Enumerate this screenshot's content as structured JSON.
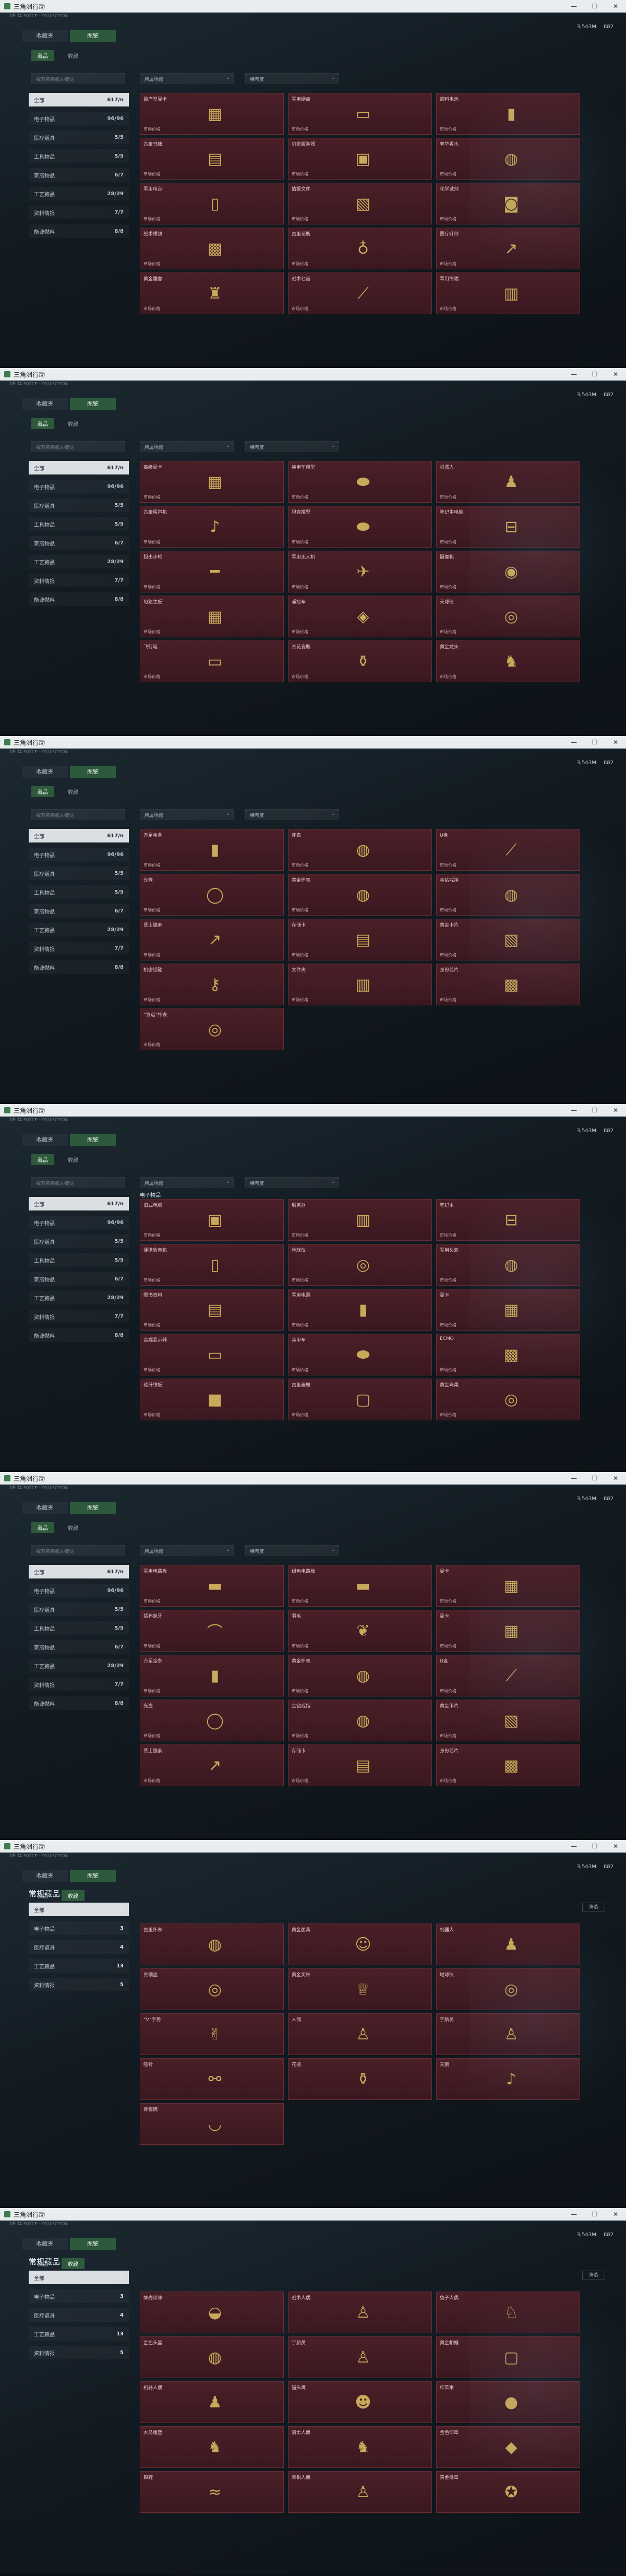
{
  "window": {
    "title": "三角洲行动",
    "min": "—",
    "max": "☐",
    "close": "✕"
  },
  "topstrip_text": "DELTA FORCE · COLLECTION",
  "currency": {
    "a": "3,543M",
    "b": "682"
  },
  "navtabs": [
    "收藏夹",
    "图鉴"
  ],
  "subtabs": [
    "藏品",
    "收藏"
  ],
  "search_placeholder": "搜索名称或关键词",
  "dropdowns": [
    "所属地图",
    "稀有度"
  ],
  "categories": [
    {
      "label": "全部",
      "count": "617/n"
    },
    {
      "label": "电子物品",
      "count": "96/96"
    },
    {
      "label": "医疗道具",
      "count": "5/5"
    },
    {
      "label": "工具物品",
      "count": "5/5"
    },
    {
      "label": "家居物品",
      "count": "6/7"
    },
    {
      "label": "工艺藏品",
      "count": "28/29"
    },
    {
      "label": "资料情报",
      "count": "7/7"
    },
    {
      "label": "能源燃料",
      "count": "8/8"
    }
  ],
  "price_label": "市场价格",
  "section_title": "电子物品",
  "header_title": "常规藏品",
  "mini_button": "筛选",
  "s6_categories": [
    {
      "label": "全部",
      "count": "25"
    },
    {
      "label": "电子物品",
      "count": "3"
    },
    {
      "label": "医疗道具",
      "count": "4"
    },
    {
      "label": "工艺藏品",
      "count": "13"
    },
    {
      "label": "资料情报",
      "count": "5"
    }
  ],
  "screens": [
    {
      "cards": [
        {
          "name": "量产型显卡",
          "icon": "chip-icon",
          "sym": "▦"
        },
        {
          "name": "军用硬盘",
          "icon": "drive-icon",
          "sym": "▭"
        },
        {
          "name": "燃料电池",
          "icon": "battery-icon",
          "sym": "▮"
        },
        {
          "name": "古董书籍",
          "icon": "book-icon",
          "sym": "▤"
        },
        {
          "name": "机密服务器",
          "icon": "server-icon",
          "sym": "▣"
        },
        {
          "name": "奢华香水",
          "icon": "perfume-icon",
          "sym": "◍"
        },
        {
          "name": "军用电台",
          "icon": "radio-icon",
          "sym": "▯"
        },
        {
          "name": "情报文件",
          "icon": "file-icon",
          "sym": "▧"
        },
        {
          "name": "化学试剂",
          "icon": "flask-icon",
          "sym": "◙"
        },
        {
          "name": "战术眼镜",
          "icon": "goggles-icon",
          "sym": "▩"
        },
        {
          "name": "古董花瓶",
          "icon": "vase-icon",
          "sym": "♁"
        },
        {
          "name": "医疗针剂",
          "icon": "syringe-icon",
          "sym": "↗"
        },
        {
          "name": "黄金雕像",
          "icon": "statue-icon",
          "sym": "♜"
        },
        {
          "name": "战术匕首",
          "icon": "knife-icon",
          "sym": "⟋"
        },
        {
          "name": "军用终端",
          "icon": "terminal-icon",
          "sym": "▥"
        }
      ]
    },
    {
      "cards": [
        {
          "name": "高级显卡",
          "icon": "gpu-icon",
          "sym": "▦"
        },
        {
          "name": "装甲车模型",
          "icon": "tank-icon",
          "sym": "⬬"
        },
        {
          "name": "机器人",
          "icon": "robot-icon",
          "sym": "♟"
        },
        {
          "name": "古董留声机",
          "icon": "gramophone-icon",
          "sym": "♪"
        },
        {
          "name": "坦克模型",
          "icon": "tank-icon",
          "sym": "⬬"
        },
        {
          "name": "笔记本电脑",
          "icon": "laptop-icon",
          "sym": "⊟"
        },
        {
          "name": "狙击步枪",
          "icon": "rifle-icon",
          "sym": "━"
        },
        {
          "name": "军用无人机",
          "icon": "drone-icon",
          "sym": "✈"
        },
        {
          "name": "摄像机",
          "icon": "camera-icon",
          "sym": "◉"
        },
        {
          "name": "电路主板",
          "icon": "board-icon",
          "sym": "▦"
        },
        {
          "name": "遥控车",
          "icon": "car-icon",
          "sym": "◈"
        },
        {
          "name": "天球仪",
          "icon": "globe-icon",
          "sym": "◎"
        },
        {
          "name": "飞行箱",
          "icon": "case-icon",
          "sym": "▭"
        },
        {
          "name": "青花瓷瓶",
          "icon": "vase-icon",
          "sym": "⚱"
        },
        {
          "name": "黄金龙头",
          "icon": "dragon-icon",
          "sym": "♞"
        }
      ]
    },
    {
      "cards": [
        {
          "name": "万足金条",
          "icon": "gold-icon",
          "sym": "▮"
        },
        {
          "name": "怀表",
          "icon": "watch-icon",
          "sym": "◍"
        },
        {
          "name": "U盘",
          "icon": "usb-icon",
          "sym": "⟋"
        },
        {
          "name": "光盘",
          "icon": "disc-icon",
          "sym": "◯"
        },
        {
          "name": "黄金怀表",
          "icon": "watch-icon",
          "sym": "◍"
        },
        {
          "name": "金钻戒指",
          "icon": "ring-icon",
          "sym": "◍"
        },
        {
          "name": "肾上腺素",
          "icon": "syringe-icon",
          "sym": "↗"
        },
        {
          "name": "存储卡",
          "icon": "card-icon",
          "sym": "▤"
        },
        {
          "name": "黄金卡片",
          "icon": "card-icon",
          "sym": "▧"
        },
        {
          "name": "机密钥匙",
          "icon": "key-icon",
          "sym": "⚷"
        },
        {
          "name": "文件夹",
          "icon": "folder-icon",
          "sym": "▥"
        },
        {
          "name": "身份芯片",
          "icon": "chip-icon",
          "sym": "▩"
        },
        {
          "name": "“致远”怀表",
          "icon": "watch-icon",
          "sym": "◎"
        }
      ]
    },
    {
      "cards": [
        {
          "name": "旧式电脑",
          "icon": "pc-icon",
          "sym": "▣"
        },
        {
          "name": "服务器",
          "icon": "server-icon",
          "sym": "▥"
        },
        {
          "name": "笔记本",
          "icon": "laptop-icon",
          "sym": "⊟"
        },
        {
          "name": "便携收音机",
          "icon": "radio-icon",
          "sym": "▯"
        },
        {
          "name": "地球仪",
          "icon": "globe-icon",
          "sym": "◎"
        },
        {
          "name": "军用头盔",
          "icon": "helmet-icon",
          "sym": "◍"
        },
        {
          "name": "图书资料",
          "icon": "book-icon",
          "sym": "▤"
        },
        {
          "name": "军用电源",
          "icon": "battery-icon",
          "sym": "▮"
        },
        {
          "name": "显卡",
          "icon": "gpu-icon",
          "sym": "▦"
        },
        {
          "name": "高端显示器",
          "icon": "monitor-icon",
          "sym": "▭"
        },
        {
          "name": "装甲车",
          "icon": "tank-icon",
          "sym": "⬬"
        },
        {
          "name": "ECMO",
          "icon": "device-icon",
          "sym": "▩"
        },
        {
          "name": "碳纤维板",
          "icon": "plate-icon",
          "sym": "■"
        },
        {
          "name": "古董画框",
          "icon": "frame-icon",
          "sym": "▢"
        },
        {
          "name": "黄金鸟巢",
          "icon": "nest-icon",
          "sym": "◎"
        }
      ]
    },
    {
      "cards": [
        {
          "name": "军用电路板",
          "icon": "board-icon",
          "sym": "▬"
        },
        {
          "name": "绿色电路板",
          "icon": "board-icon",
          "sym": "▬"
        },
        {
          "name": "显卡",
          "icon": "gpu-icon",
          "sym": "▦"
        },
        {
          "name": "猛犸象牙",
          "icon": "tusk-icon",
          "sym": "⌒"
        },
        {
          "name": "羽毛",
          "icon": "feather-icon",
          "sym": "❦"
        },
        {
          "name": "显卡",
          "icon": "gpu-icon",
          "sym": "▦"
        },
        {
          "name": "万足金条",
          "icon": "gold-icon",
          "sym": "▮"
        },
        {
          "name": "黄金怀表",
          "icon": "watch-icon",
          "sym": "◍"
        },
        {
          "name": "U盘",
          "icon": "usb-icon",
          "sym": "⟋"
        },
        {
          "name": "光盘",
          "icon": "disc-icon",
          "sym": "◯"
        },
        {
          "name": "金钻戒指",
          "icon": "ring-icon",
          "sym": "◍"
        },
        {
          "name": "黄金卡片",
          "icon": "card-icon",
          "sym": "▧"
        },
        {
          "name": "肾上腺素",
          "icon": "syringe-icon",
          "sym": "↗"
        },
        {
          "name": "存储卡",
          "icon": "card-icon",
          "sym": "▤"
        },
        {
          "name": "身份芯片",
          "icon": "chip-icon",
          "sym": "▩"
        }
      ]
    },
    {
      "cards": [
        {
          "name": "古董怀表",
          "icon": "watch-icon",
          "sym": "◍"
        },
        {
          "name": "黄金面具",
          "icon": "mask-icon",
          "sym": "☺"
        },
        {
          "name": "机器人",
          "icon": "robot-icon",
          "sym": "♟"
        },
        {
          "name": "青铜盘",
          "icon": "plate-icon",
          "sym": "◎"
        },
        {
          "name": "黄金奖杯",
          "icon": "trophy-icon",
          "sym": "♕"
        },
        {
          "name": "地球仪",
          "icon": "globe-icon",
          "sym": "◎"
        },
        {
          "name": "“V”手势",
          "icon": "hand-icon",
          "sym": "✌"
        },
        {
          "name": "人偶",
          "icon": "doll-icon",
          "sym": "♙"
        },
        {
          "name": "宇航员",
          "icon": "astronaut-icon",
          "sym": "♙"
        },
        {
          "name": "哑铃",
          "icon": "dumbbell-icon",
          "sym": "⚯"
        },
        {
          "name": "花瓶",
          "icon": "vase-icon",
          "sym": "⚱"
        },
        {
          "name": "天鹅",
          "icon": "swan-icon",
          "sym": "♪"
        },
        {
          "name": "青瓷碗",
          "icon": "bowl-icon",
          "sym": "◡"
        }
      ]
    },
    {
      "cards": [
        {
          "name": "蚌壳珍珠",
          "icon": "shell-icon",
          "sym": "◒"
        },
        {
          "name": "战术人偶",
          "icon": "doll-icon",
          "sym": "♙"
        },
        {
          "name": "兔子人偶",
          "icon": "rabbit-icon",
          "sym": "♘"
        },
        {
          "name": "金色头盔",
          "icon": "helmet-icon",
          "sym": "◍"
        },
        {
          "name": "宇航员",
          "icon": "astronaut-icon",
          "sym": "♙"
        },
        {
          "name": "黄金相框",
          "icon": "frame-icon",
          "sym": "▢"
        },
        {
          "name": "机器人偶",
          "icon": "robot-icon",
          "sym": "♟"
        },
        {
          "name": "猫头鹰",
          "icon": "owl-icon",
          "sym": "☻"
        },
        {
          "name": "红苹果",
          "icon": "apple-icon",
          "sym": "●"
        },
        {
          "name": "木马雕塑",
          "icon": "horse-icon",
          "sym": "♞"
        },
        {
          "name": "骑士人偶",
          "icon": "knight-icon",
          "sym": "♞"
        },
        {
          "name": "金色印章",
          "icon": "seal-icon",
          "sym": "◆"
        },
        {
          "name": "锦鲤",
          "icon": "fish-icon",
          "sym": "≈"
        },
        {
          "name": "青铜人偶",
          "icon": "statue-icon",
          "sym": "♙"
        },
        {
          "name": "黄金徽章",
          "icon": "badge-icon",
          "sym": "✪"
        }
      ]
    }
  ]
}
